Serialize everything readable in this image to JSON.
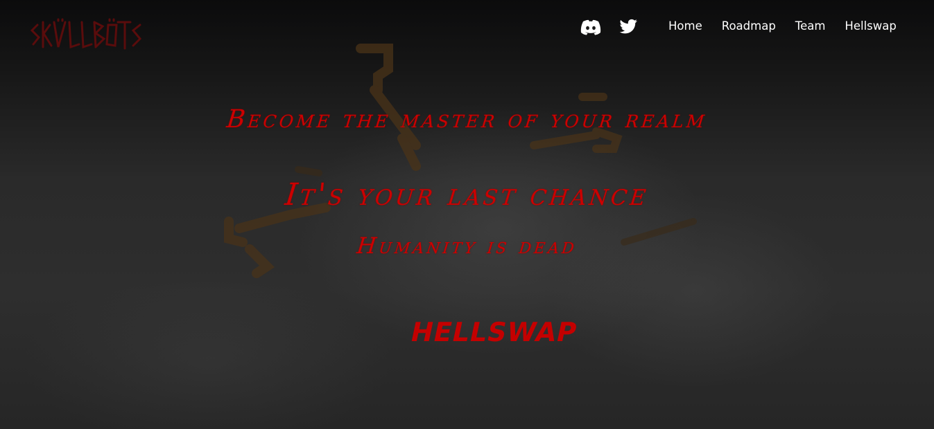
{
  "brand": {
    "logo_text": "SKÜLLBÖTS"
  },
  "header": {
    "social": [
      {
        "icon": "discord-icon"
      },
      {
        "icon": "twitter-icon"
      }
    ],
    "nav": [
      {
        "label": "Home"
      },
      {
        "label": "Roadmap"
      },
      {
        "label": "Team"
      },
      {
        "label": "Hellswap"
      }
    ]
  },
  "hero": {
    "line1": "Become the master of your realm",
    "line2": "It's your last chance",
    "line3": "Humanity is dead",
    "cta_label": "HELLSWAP"
  },
  "colors": {
    "accent_red": "#cc0000",
    "logo_red": "#5a0c0c",
    "nav_text": "#ffffff",
    "background": "#1c1c1c"
  }
}
